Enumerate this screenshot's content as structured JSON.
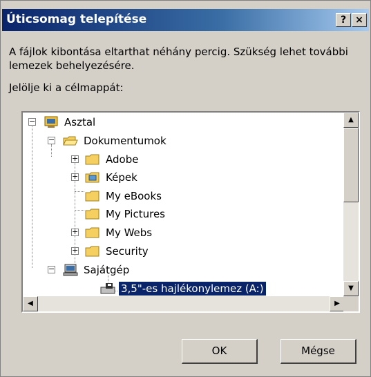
{
  "window": {
    "title": "Úticsomag telepítése",
    "help_button": "?",
    "close_button": "×"
  },
  "description": "A fájlok kibontása eltarthat néhány percig. Szükség lehet további lemezek behelyezésére.",
  "prompt": "Jelölje ki a célmappát:",
  "tree": {
    "nodes": [
      {
        "label": "Asztal",
        "icon": "desktop-icon",
        "expander": "−"
      },
      {
        "label": "Dokumentumok",
        "icon": "folder-open-icon",
        "expander": "−"
      },
      {
        "label": "Adobe",
        "icon": "folder-icon",
        "expander": "+"
      },
      {
        "label": "Képek",
        "icon": "folder-pictures-icon",
        "expander": "+"
      },
      {
        "label": "My eBooks",
        "icon": "folder-icon",
        "expander": ""
      },
      {
        "label": "My Pictures",
        "icon": "folder-icon",
        "expander": ""
      },
      {
        "label": "My Webs",
        "icon": "folder-icon",
        "expander": "+"
      },
      {
        "label": "Security",
        "icon": "folder-icon",
        "expander": "+"
      },
      {
        "label": "Sajátgép",
        "icon": "computer-icon",
        "expander": "−"
      },
      {
        "label": "3,5\"-es hajlékonylemez (A:)",
        "icon": "floppy-drive-icon",
        "expander": "",
        "selected": true
      }
    ]
  },
  "buttons": {
    "ok": "OK",
    "cancel": "Mégse"
  },
  "colors": {
    "title_gradient_start": "#0a246a",
    "title_gradient_end": "#a6caf0",
    "dialog_bg": "#d4d0c8",
    "selection": "#0a246a"
  }
}
